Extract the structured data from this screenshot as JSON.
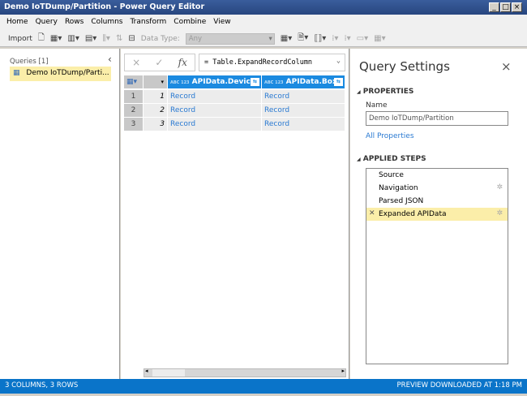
{
  "window": {
    "title": "Demo IoTDump/Partition - Power Query Editor",
    "min": "_",
    "max": "□",
    "close": "×"
  },
  "menu": [
    "Home",
    "Query",
    "Rows",
    "Columns",
    "Transform",
    "Combine",
    "View"
  ],
  "toolbar": {
    "import": "Import",
    "data_type_label": "Data Type:",
    "data_type_value": "Any"
  },
  "queries": {
    "header": "Queries [1]",
    "items": [
      "Demo IoTDump/Parti..."
    ]
  },
  "formula": {
    "cancel": "×",
    "commit": "✓",
    "fx": "fx",
    "text": "= Table.ExpandRecordColumn"
  },
  "table": {
    "columns": [
      {
        "type": "ABC 123",
        "name": "APIData.Device"
      },
      {
        "type": "ABC 123",
        "name": "APIData.Box"
      }
    ],
    "rows": [
      {
        "n": "1",
        "idx": "1",
        "c1": "Record",
        "c2": "Record"
      },
      {
        "n": "2",
        "idx": "2",
        "c1": "Record",
        "c2": "Record"
      },
      {
        "n": "3",
        "idx": "3",
        "c1": "Record",
        "c2": "Record"
      }
    ]
  },
  "settings": {
    "title": "Query Settings",
    "properties": "PROPERTIES",
    "name_label": "Name",
    "name_value": "Demo IoTDump/Partition",
    "all_properties": "All Properties",
    "applied_steps": "APPLIED STEPS",
    "steps": [
      "Source",
      "Navigation",
      "Parsed JSON",
      "Expanded APIData"
    ]
  },
  "status": {
    "left": "3 COLUMNS, 3 ROWS",
    "right": "PREVIEW DOWNLOADED AT 1:18 PM"
  }
}
